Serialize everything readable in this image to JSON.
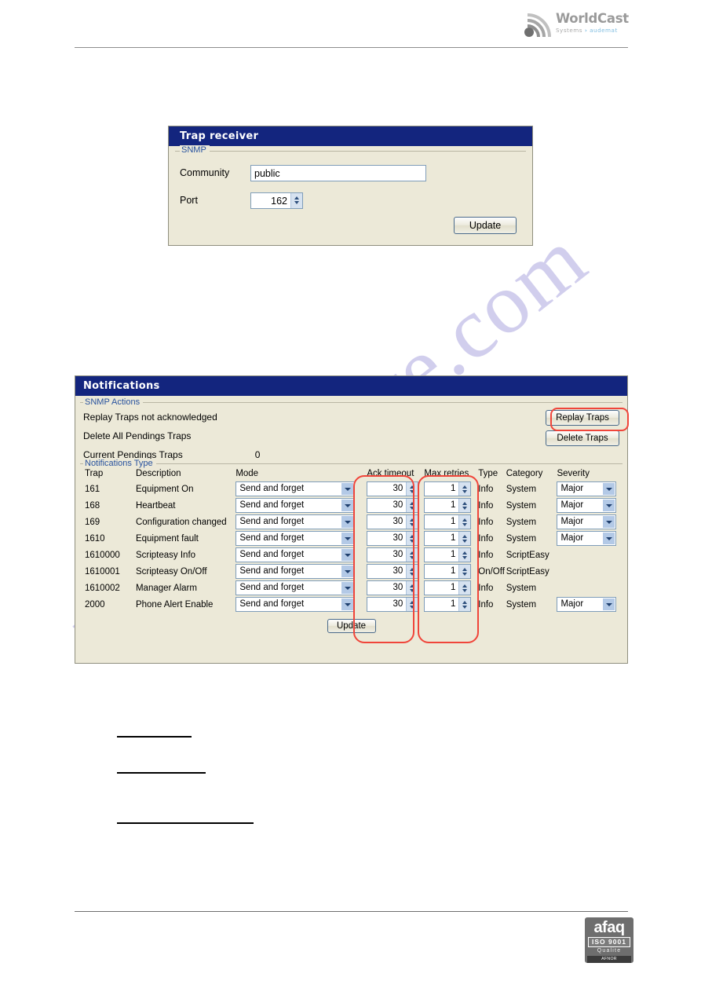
{
  "document": {
    "watermark": "manualshive.com",
    "logo": {
      "main": "WorldCast",
      "sub_prefix": "Systems",
      "sub_chevron": "›",
      "sub_brand": "audemat",
      "icon": "signal-waves-icon"
    },
    "footer_badge": {
      "brand": "afaq",
      "standard": "ISO 9001",
      "quality": "Qualite",
      "certifier": "AFNOR CERTIFICATION"
    }
  },
  "colors": {
    "titlebar": "#13257e",
    "panel_body": "#ece9d8",
    "legend_text": "#28529e",
    "annotation": "#f0453a",
    "field_border": "#7f9db9",
    "watermark": "#c9c6ea"
  },
  "trap_receiver": {
    "title": "Trap receiver",
    "group_legend": "SNMP",
    "community_label": "Community",
    "community_value": "public",
    "community_placeholder": "public",
    "port_label": "Port",
    "port_value": "162",
    "update_label": "Update"
  },
  "notifications": {
    "title": "Notifications",
    "snmp_actions": {
      "legend": "SNMP Actions",
      "rows": [
        {
          "label": "Replay Traps not acknowledged",
          "value": ""
        },
        {
          "label": "Delete All Pendings Traps",
          "value": ""
        },
        {
          "label": "Current Pendings Traps",
          "value": "0"
        }
      ],
      "replay_button": "Replay Traps",
      "delete_button": "Delete Traps"
    },
    "notifications_type": {
      "legend": "Notifications Type",
      "columns": [
        "Trap",
        "Description",
        "Mode",
        "Ack timeout",
        "Max retries",
        "Type",
        "Category",
        "Severity"
      ],
      "rows": [
        {
          "trap": "161",
          "description": "Equipment On",
          "mode": "Send and forget",
          "ack_timeout": "30",
          "max_retries": "1",
          "type": "Info",
          "category": "System",
          "severity": "Major"
        },
        {
          "trap": "168",
          "description": "Heartbeat",
          "mode": "Send and forget",
          "ack_timeout": "30",
          "max_retries": "1",
          "type": "Info",
          "category": "System",
          "severity": "Major"
        },
        {
          "trap": "169",
          "description": "Configuration changed",
          "mode": "Send and forget",
          "ack_timeout": "30",
          "max_retries": "1",
          "type": "Info",
          "category": "System",
          "severity": "Major"
        },
        {
          "trap": "1610",
          "description": "Equipment fault",
          "mode": "Send and forget",
          "ack_timeout": "30",
          "max_retries": "1",
          "type": "Info",
          "category": "System",
          "severity": "Major"
        },
        {
          "trap": "1610000",
          "description": "Scripteasy Info",
          "mode": "Send and forget",
          "ack_timeout": "30",
          "max_retries": "1",
          "type": "Info",
          "category": "ScriptEasy",
          "severity": null
        },
        {
          "trap": "1610001",
          "description": "Scripteasy On/Off",
          "mode": "Send and forget",
          "ack_timeout": "30",
          "max_retries": "1",
          "type": "On/Off",
          "category": "ScriptEasy",
          "severity": null
        },
        {
          "trap": "1610002",
          "description": "Manager Alarm",
          "mode": "Send and forget",
          "ack_timeout": "30",
          "max_retries": "1",
          "type": "Info",
          "category": "System",
          "severity": null
        },
        {
          "trap": "2000",
          "description": "Phone Alert Enable",
          "mode": "Send and forget",
          "ack_timeout": "30",
          "max_retries": "1",
          "type": "Info",
          "category": "System",
          "severity": "Major"
        }
      ],
      "update_label": "Update"
    }
  },
  "annotations": [
    {
      "name": "ack-timeout-highlight",
      "target": "Ack timeout column"
    },
    {
      "name": "max-retries-highlight",
      "target": "Max retries column"
    },
    {
      "name": "replay-traps-highlight",
      "target": "Replay Traps button"
    }
  ]
}
